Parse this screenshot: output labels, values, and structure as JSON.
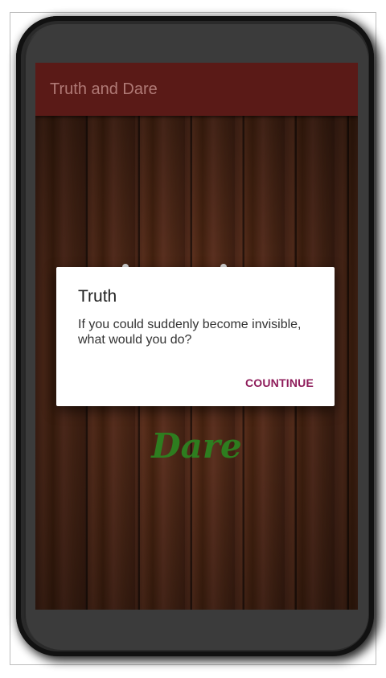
{
  "app_bar": {
    "title": "Truth and Dare"
  },
  "game": {
    "dare_label": "Dare"
  },
  "dialog": {
    "title": "Truth",
    "message": "If you could suddenly become invisible, what would you do?",
    "button_label": "COUNTINUE"
  },
  "colors": {
    "app_bar": "#5a1a17",
    "dare_text": "#2e7d1f",
    "dialog_button": "#8e1c5a"
  }
}
